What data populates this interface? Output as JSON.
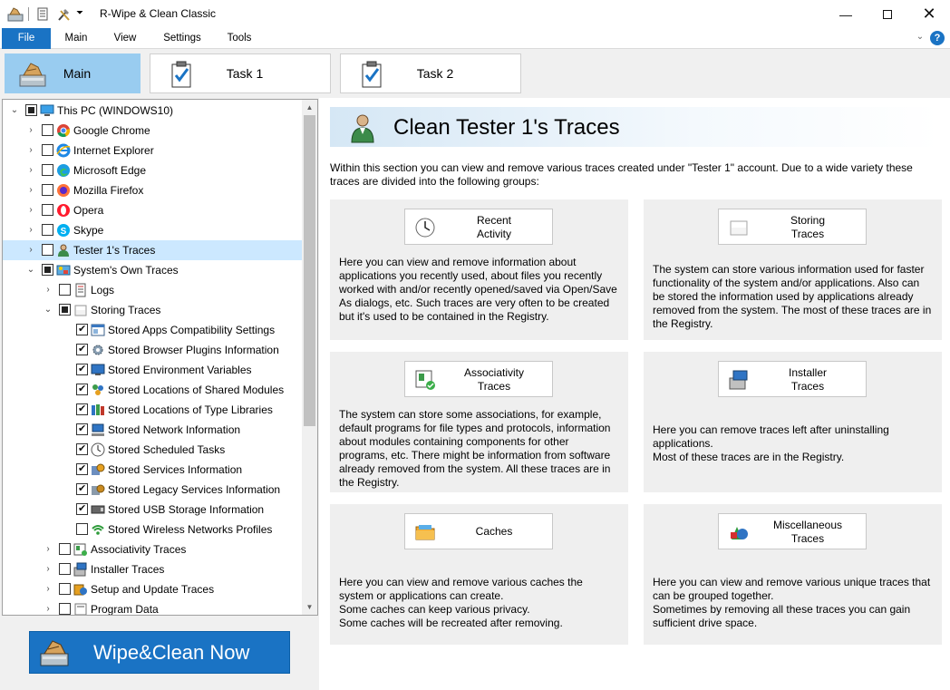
{
  "window": {
    "title": "R-Wipe & Clean Classic",
    "minimize_icon": "minimize-icon",
    "maximize_icon": "maximize-icon",
    "close_icon": "close-icon"
  },
  "menu": {
    "items": [
      "File",
      "Main",
      "View",
      "Settings",
      "Tools"
    ]
  },
  "tabs": [
    {
      "label": "Main",
      "icon": "wipe-icon",
      "active": true
    },
    {
      "label": "Task 1",
      "icon": "task-icon",
      "active": false
    },
    {
      "label": "Task 2",
      "icon": "task-icon",
      "active": false
    }
  ],
  "tree": {
    "rows": [
      {
        "label": "This PC  (WINDOWS10)",
        "level": 0,
        "expander": "open",
        "check": "partial",
        "icon": "computer-icon"
      },
      {
        "label": "Google Chrome",
        "level": 1,
        "expander": "closed",
        "check": "none",
        "icon": "chrome-icon"
      },
      {
        "label": "Internet  Explorer",
        "level": 1,
        "expander": "closed",
        "check": "none",
        "icon": "ie-icon"
      },
      {
        "label": "Microsoft Edge",
        "level": 1,
        "expander": "closed",
        "check": "none",
        "icon": "edge-icon"
      },
      {
        "label": "Mozilla Firefox",
        "level": 1,
        "expander": "closed",
        "check": "none",
        "icon": "firefox-icon"
      },
      {
        "label": "Opera",
        "level": 1,
        "expander": "closed",
        "check": "none",
        "icon": "opera-icon"
      },
      {
        "label": "Skype",
        "level": 1,
        "expander": "closed",
        "check": "none",
        "icon": "skype-icon"
      },
      {
        "label": "Tester 1's Traces",
        "level": 1,
        "expander": "closed",
        "check": "none",
        "icon": "user-icon",
        "selected": true
      },
      {
        "label": "System's Own Traces",
        "level": 1,
        "expander": "open",
        "check": "partial",
        "icon": "system-icon"
      },
      {
        "label": "Logs",
        "level": 2,
        "expander": "closed",
        "check": "none",
        "icon": "logs-icon"
      },
      {
        "label": "Storing Traces",
        "level": 2,
        "expander": "open",
        "check": "partial",
        "icon": "storage-icon"
      },
      {
        "label": "Stored Apps Compatibility Settings",
        "level": 3,
        "expander": "",
        "check": "checked",
        "icon": "app-settings-icon"
      },
      {
        "label": "Stored Browser Plugins Information",
        "level": 3,
        "expander": "",
        "check": "checked",
        "icon": "gear-icon"
      },
      {
        "label": "Stored Environment Variables",
        "level": 3,
        "expander": "",
        "check": "checked",
        "icon": "monitor-icon"
      },
      {
        "label": "Stored Locations of Shared Modules",
        "level": 3,
        "expander": "",
        "check": "checked",
        "icon": "modules-icon"
      },
      {
        "label": "Stored Locations of Type Libraries",
        "level": 3,
        "expander": "",
        "check": "checked",
        "icon": "library-icon"
      },
      {
        "label": "Stored Network Information",
        "level": 3,
        "expander": "",
        "check": "checked",
        "icon": "network-icon"
      },
      {
        "label": "Stored Scheduled Tasks",
        "level": 3,
        "expander": "",
        "check": "checked",
        "icon": "clock-icon"
      },
      {
        "label": "Stored Services Information",
        "level": 3,
        "expander": "",
        "check": "checked",
        "icon": "services-icon"
      },
      {
        "label": "Stored Legacy Services Information",
        "level": 3,
        "expander": "",
        "check": "checked",
        "icon": "legacy-services-icon"
      },
      {
        "label": "Stored USB Storage Information",
        "level": 3,
        "expander": "",
        "check": "checked",
        "icon": "usb-icon"
      },
      {
        "label": "Stored Wireless Networks Profiles",
        "level": 3,
        "expander": "",
        "check": "none",
        "icon": "wifi-icon"
      },
      {
        "label": "Associativity Traces",
        "level": 2,
        "expander": "closed",
        "check": "none",
        "icon": "associativity-icon"
      },
      {
        "label": "Installer Traces",
        "level": 2,
        "expander": "closed",
        "check": "none",
        "icon": "installer-icon"
      },
      {
        "label": "Setup and Update Traces",
        "level": 2,
        "expander": "closed",
        "check": "none",
        "icon": "setup-icon"
      },
      {
        "label": "Program Data",
        "level": 2,
        "expander": "closed",
        "check": "none",
        "icon": "program-data-icon"
      }
    ]
  },
  "wipe_button": {
    "label": "Wipe&Clean Now",
    "icon": "wipe-icon"
  },
  "content": {
    "title": "Clean Tester 1's Traces",
    "title_icon": "user-icon",
    "intro": "Within this section you can view and remove various traces created under \"Tester 1\" account. Due to a wide variety these traces are divided into the following groups:",
    "cards": [
      {
        "button_line1": "Recent",
        "button_line2": "Activity",
        "icon": "clock-icon",
        "text": "Here you can view and remove information about applications you recently used, about files you recently worked with and/or recently opened/saved via Open/Save As dialogs, etc. Such traces are very often to be created but it's used to be contained in the Registry."
      },
      {
        "button_line1": "Storing",
        "button_line2": "Traces",
        "icon": "storage-icon",
        "text": "The system can store various information used for faster functionality of the system and/or applications. Also can be stored the information used by applications already removed from the system. The most of these traces are in the Registry."
      },
      {
        "button_line1": "Associativity",
        "button_line2": "Traces",
        "icon": "associativity-icon",
        "text": "The system can store some associations, for example, default programs for file types and protocols, information about modules containing components for other programs, etc. There might be information from software already removed from the system. All these traces are in the Registry."
      },
      {
        "button_line1": "Installer",
        "button_line2": "Traces",
        "icon": "installer-icon",
        "text": "Here you can remove traces left after uninstalling applications.\nMost of these traces are in the Registry."
      },
      {
        "button_line1": "Caches",
        "button_line2": "",
        "icon": "folder-icon",
        "text": "Here you can view and remove various caches the system or applications can create.\nSome caches can keep various privacy.\nSome caches will be recreated after removing."
      },
      {
        "button_line1": "Miscellaneous",
        "button_line2": "Traces",
        "icon": "shapes-icon",
        "text": "Here you can view and remove various unique traces that can be grouped together.\nSometimes by removing all these traces you can gain sufficient drive space."
      }
    ]
  }
}
